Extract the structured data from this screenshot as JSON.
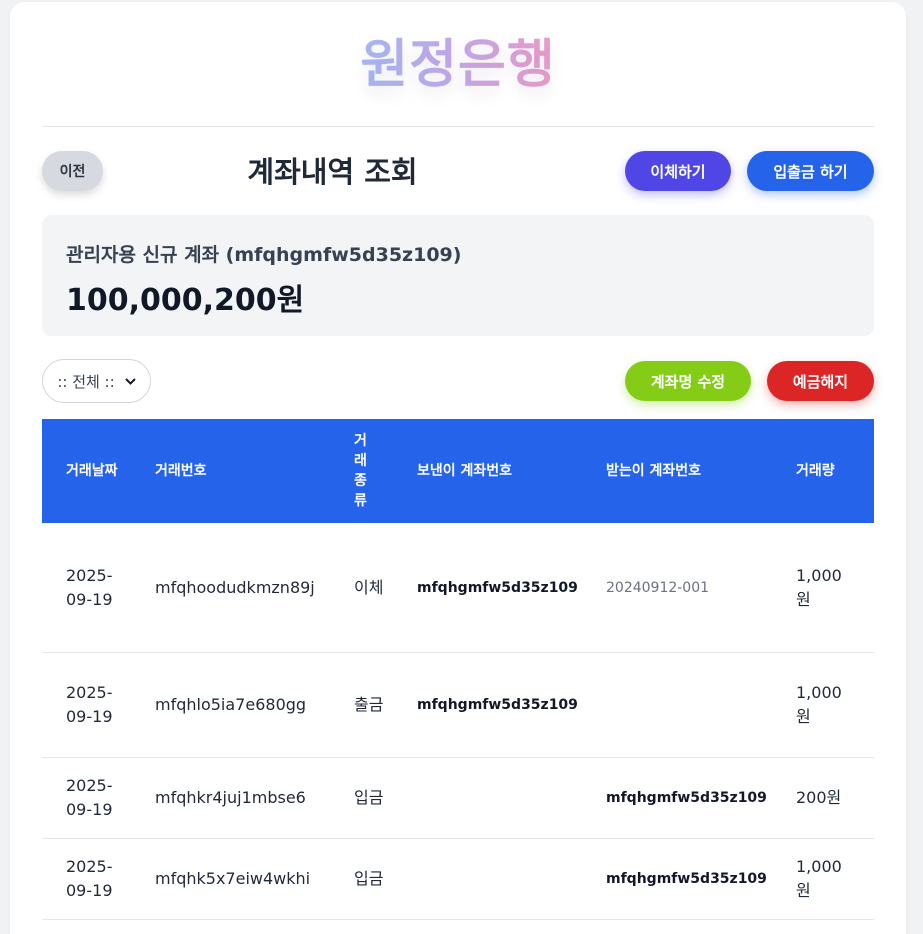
{
  "brand": {
    "title": "원정은행"
  },
  "header": {
    "prev_label": "이전",
    "page_title": "계좌내역 조회",
    "transfer_label": "이체하기",
    "deposit_label": "입출금 하기"
  },
  "account": {
    "name": "관리자용 신규 계좌 (mfqhgmfw5d35z109)",
    "balance": "100,000,200원"
  },
  "filter": {
    "selected": ":: 전체 ::"
  },
  "actions": {
    "rename_label": "계좌명 수정",
    "close_label": "예금해지"
  },
  "table": {
    "columns": [
      "거래날짜",
      "거래번호",
      "거래종류",
      "보낸이 계좌번호",
      "받는이 계좌번호",
      "거래량"
    ],
    "rows": [
      {
        "date": "2025-09-19",
        "id": "mfqhoodudkmzn89j",
        "type": "이체",
        "from": "mfqhgmfw5d35z109",
        "to": "20240912-001",
        "amount": "1,000원"
      },
      {
        "date": "2025-09-19",
        "id": "mfqhlo5ia7e680gg",
        "type": "출금",
        "from": "mfqhgmfw5d35z109",
        "to": "",
        "amount": "1,000원"
      },
      {
        "date": "2025-09-19",
        "id": "mfqhkr4juj1mbse6",
        "type": "입금",
        "from": "",
        "to": "mfqhgmfw5d35z109",
        "amount": "200원"
      },
      {
        "date": "2025-09-19",
        "id": "mfqhk5x7eiw4wkhi",
        "type": "입금",
        "from": "",
        "to": "mfqhgmfw5d35z109",
        "amount": "1,000원"
      }
    ]
  }
}
